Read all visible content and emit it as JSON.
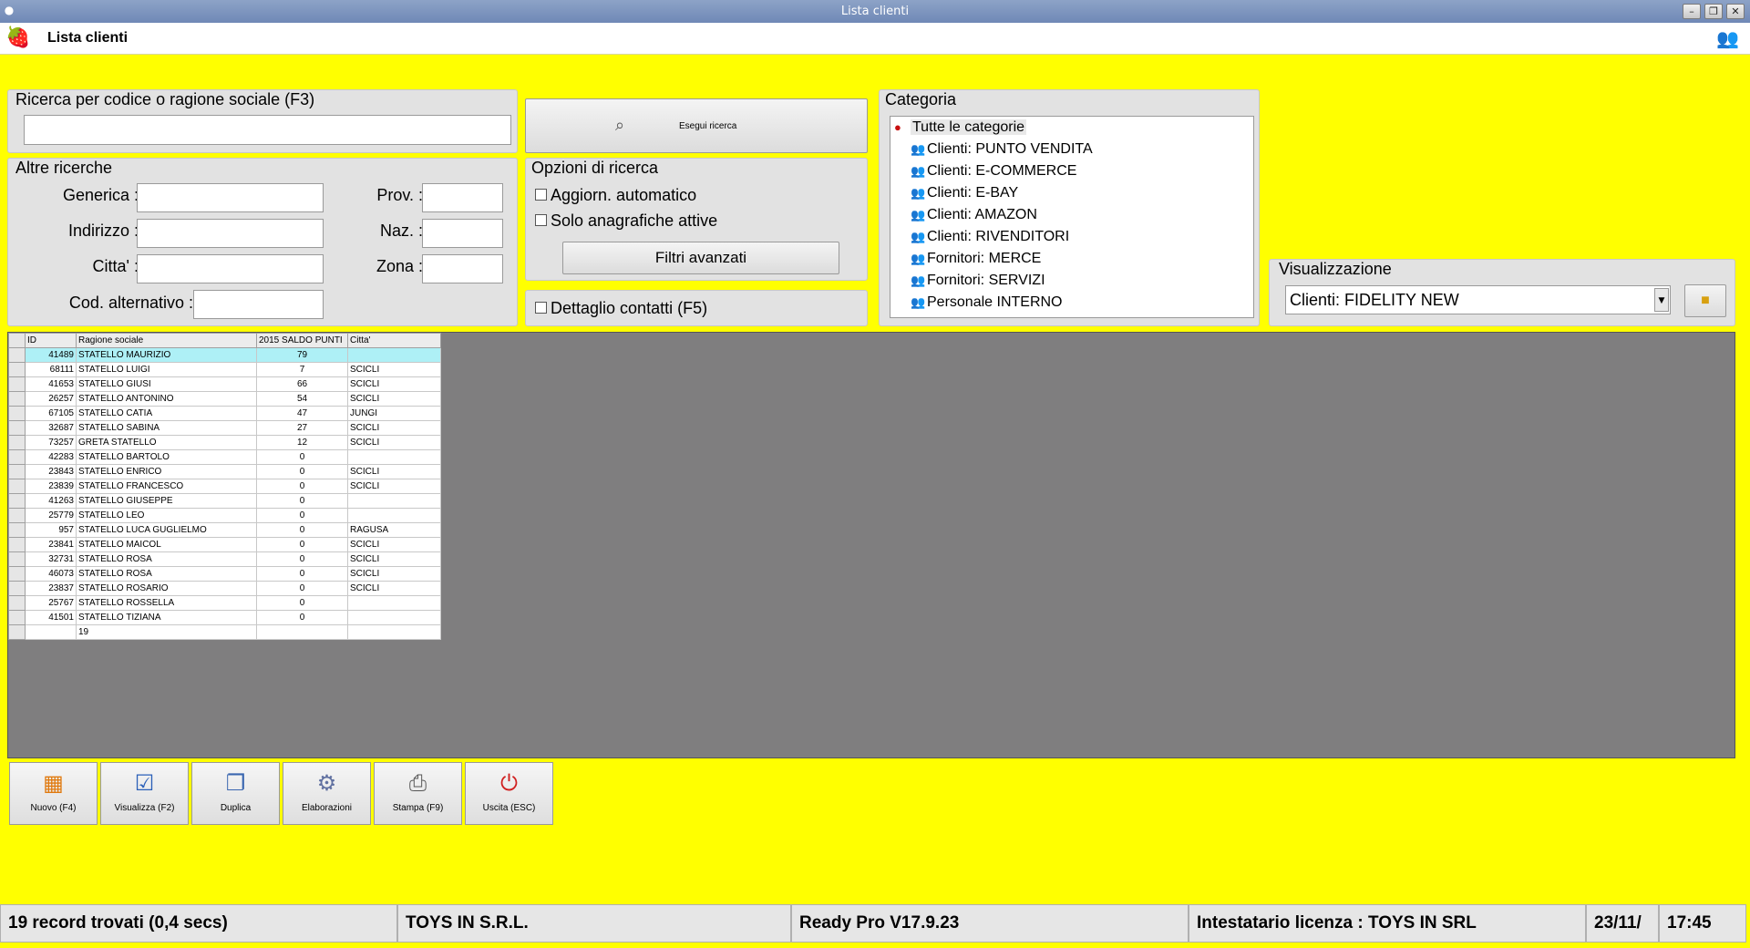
{
  "window": {
    "title": "Lista clienti",
    "min": "–",
    "max": "❐",
    "close": "✕"
  },
  "header": {
    "title": "Lista clienti"
  },
  "search": {
    "legend": "Ricerca per codice o ragione sociale (F3)",
    "value": "",
    "button": "Esegui ricerca"
  },
  "altre": {
    "legend": "Altre ricerche",
    "generica": "Generica :",
    "indirizzo": "Indirizzo :",
    "citta": "Citta' :",
    "cod_alt": "Cod. alternativo :",
    "prov": "Prov. :",
    "naz": "Naz. :",
    "zona": "Zona :"
  },
  "opzioni": {
    "legend": "Opzioni di ricerca",
    "auto": "Aggiorn. automatico",
    "attive": "Solo anagrafiche attive",
    "filtri": "Filtri avanzati",
    "dettaglio": "Dettaglio contatti (F5)"
  },
  "categoria": {
    "legend": "Categoria",
    "root": "Tutte le categorie",
    "items": [
      "Clienti: PUNTO VENDITA",
      "Clienti: E-COMMERCE",
      "Clienti: E-BAY",
      "Clienti: AMAZON",
      "Clienti: RIVENDITORI",
      "Fornitori: MERCE",
      "Fornitori: SERVIZI",
      "Personale INTERNO"
    ]
  },
  "visualizzazione": {
    "legend": "Visualizzazione",
    "value": "Clienti: FIDELITY NEW"
  },
  "grid": {
    "headers": [
      "ID",
      "Ragione sociale",
      "2015 SALDO PUNTI",
      "Citta'"
    ],
    "rows": [
      [
        "41489",
        "STATELLO MAURIZIO",
        "79",
        ""
      ],
      [
        "68111",
        "STATELLO LUIGI",
        "7",
        "SCICLI"
      ],
      [
        "41653",
        "STATELLO GIUSI",
        "66",
        "SCICLI"
      ],
      [
        "26257",
        "STATELLO ANTONINO",
        "54",
        "SCICLI"
      ],
      [
        "67105",
        "STATELLO CATIA",
        "47",
        "JUNGI"
      ],
      [
        "32687",
        "STATELLO SABINA",
        "27",
        "SCICLI"
      ],
      [
        "73257",
        "GRETA STATELLO",
        "12",
        "SCICLI"
      ],
      [
        "42283",
        "STATELLO BARTOLO",
        "0",
        ""
      ],
      [
        "23843",
        "STATELLO ENRICO",
        "0",
        "SCICLI"
      ],
      [
        "23839",
        "STATELLO FRANCESCO",
        "0",
        "SCICLI"
      ],
      [
        "41263",
        "STATELLO GIUSEPPE",
        "0",
        ""
      ],
      [
        "25779",
        "STATELLO LEO",
        "0",
        ""
      ],
      [
        "957",
        "STATELLO LUCA GUGLIELMO",
        "0",
        "RAGUSA"
      ],
      [
        "23841",
        "STATELLO MAICOL",
        "0",
        "SCICLI"
      ],
      [
        "32731",
        "STATELLO ROSA",
        "0",
        "SCICLI"
      ],
      [
        "46073",
        "STATELLO ROSA",
        "0",
        "SCICLI"
      ],
      [
        "23837",
        "STATELLO ROSARIO",
        "0",
        "SCICLI"
      ],
      [
        "25767",
        "STATELLO ROSSELLA",
        "0",
        ""
      ],
      [
        "41501",
        "STATELLO TIZIANA",
        "0",
        ""
      ]
    ],
    "footer_count": "19"
  },
  "toolbar": [
    {
      "label": "Nuovo (F4)",
      "icon": "new-record-icon",
      "glyph": "▦",
      "color": "#e07a10"
    },
    {
      "label": "Visualizza (F2)",
      "icon": "view-record-icon",
      "glyph": "☑",
      "color": "#2a5fb8"
    },
    {
      "label": "Duplica",
      "icon": "duplicate-icon",
      "glyph": "❐",
      "color": "#3a66b0"
    },
    {
      "label": "Elaborazioni",
      "icon": "process-icon",
      "glyph": "⚙",
      "color": "#6070a0"
    },
    {
      "label": "Stampa (F9)",
      "icon": "printer-icon",
      "glyph": "⎙",
      "color": "#555555"
    },
    {
      "label": "Uscita (ESC)",
      "icon": "exit-icon",
      "glyph": "⏻",
      "color": "#d02020"
    }
  ],
  "status": {
    "records": "19 record trovati (0,4 secs)",
    "company": "TOYS IN S.R.L.",
    "version": "Ready Pro V17.9.23",
    "license": "Intestatario licenza : TOYS IN SRL",
    "date": "23/11/",
    "time": "17:45"
  }
}
